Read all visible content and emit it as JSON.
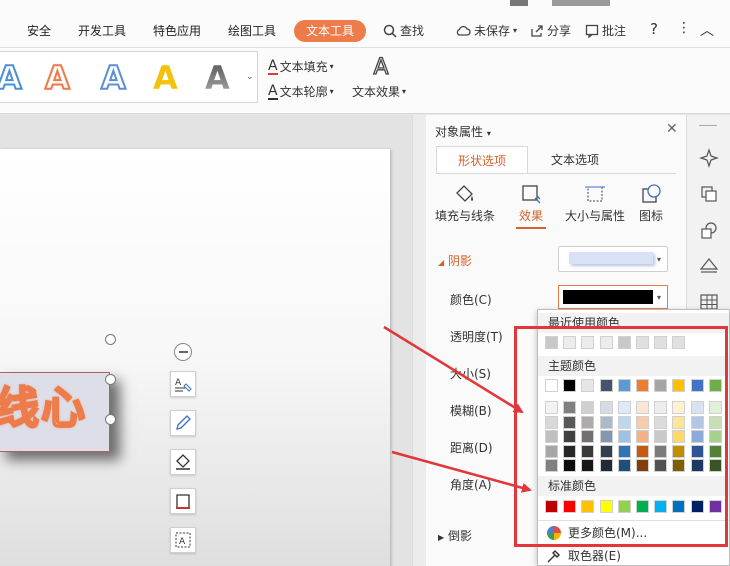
{
  "menu": {
    "items": [
      "安全",
      "开发工具",
      "特色应用",
      "绘图工具"
    ],
    "active_tab": "文本工具",
    "search": "查找",
    "unsaved": "未保存",
    "share": "分享",
    "annotate": "批注",
    "help": "?",
    "more": "⋮",
    "collapse": "︿"
  },
  "ribbon": {
    "gallery_letter": "A",
    "text_fill": "文本填充",
    "text_outline": "文本轮廓",
    "text_effect": "文本效果"
  },
  "canvas": {
    "textbox_text": "线心"
  },
  "panel": {
    "title": "对象属性",
    "close": "✕",
    "tabs": [
      "形状选项",
      "文本选项"
    ],
    "sub_tabs": [
      "填充与线条",
      "效果",
      "大小与属性",
      "图标"
    ],
    "section_shadow": "阴影",
    "labels": {
      "color": "颜色(C)",
      "transparency": "透明度(T)",
      "size": "大小(S)",
      "blur": "模糊(B)",
      "distance": "距离(D)",
      "angle": "角度(A)"
    },
    "section_reflect": "倒影"
  },
  "picker": {
    "recent_title": "最近使用颜色",
    "theme_title": "主题颜色",
    "standard_title": "标准颜色",
    "more_colors": "更多颜色(M)...",
    "eyedropper": "取色器(E)",
    "recent_colors": [
      "#c8c8c8",
      "#ececec",
      "#ececec",
      "#ececec",
      "#c8c8c8",
      "#e0e0e0",
      "#e0e0e0",
      "#e0e0e0"
    ],
    "theme_top": [
      "#ffffff",
      "#000000",
      "#e7e6e6",
      "#44546a",
      "#5b9bd5",
      "#ed7d31",
      "#a5a5a5",
      "#ffc000",
      "#4472c4",
      "#70ad47"
    ],
    "theme_shades": [
      [
        "#f2f2f2",
        "#808080",
        "#d0cece",
        "#d6dce4",
        "#deebf6",
        "#fbe5d5",
        "#ededed",
        "#fff2cc",
        "#d9e2f3",
        "#e2efd9"
      ],
      [
        "#d9d9d9",
        "#595959",
        "#aeabab",
        "#adb9ca",
        "#bdd7ee",
        "#f8cbad",
        "#dbdbdb",
        "#ffe599",
        "#b4c6e7",
        "#c5e0b3"
      ],
      [
        "#bfbfbf",
        "#404040",
        "#757070",
        "#8496b0",
        "#9cc3e5",
        "#f4b183",
        "#c9c9c9",
        "#ffd965",
        "#8eaadb",
        "#a8d08d"
      ],
      [
        "#a6a6a6",
        "#262626",
        "#3a3838",
        "#323f4f",
        "#2e75b5",
        "#c55a11",
        "#7b7b7b",
        "#bf8f00",
        "#2f5496",
        "#538135"
      ],
      [
        "#808080",
        "#0d0d0d",
        "#171616",
        "#222a35",
        "#1e4e79",
        "#833c0b",
        "#525252",
        "#7f6000",
        "#1f3864",
        "#375623"
      ]
    ],
    "standard_colors": [
      "#c00000",
      "#ff0000",
      "#ffc000",
      "#ffff00",
      "#92d050",
      "#00b050",
      "#00b0f0",
      "#0070c0",
      "#002060",
      "#7030a0"
    ]
  },
  "colors": {
    "accent": "#ee7b4a",
    "annotation_red": "#e2363b"
  }
}
